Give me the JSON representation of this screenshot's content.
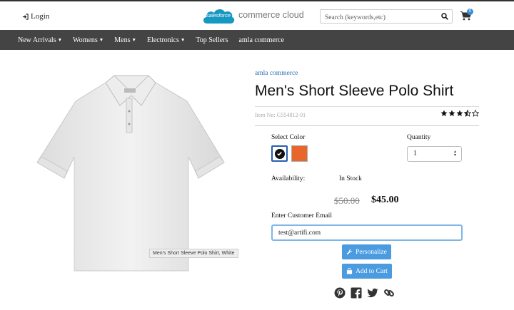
{
  "header": {
    "login_label": "Login",
    "logo_cloud_text": "salesforce",
    "logo_text": "commerce cloud",
    "search_placeholder": "Search (keywords,etc)",
    "cart_count": "0"
  },
  "nav": {
    "items": [
      {
        "label": "New Arrivals",
        "has_dropdown": true
      },
      {
        "label": "Womens",
        "has_dropdown": true
      },
      {
        "label": "Mens",
        "has_dropdown": true
      },
      {
        "label": "Electronics",
        "has_dropdown": true
      },
      {
        "label": "Top Sellers",
        "has_dropdown": false
      },
      {
        "label": "amla commerce",
        "has_dropdown": false
      }
    ]
  },
  "product": {
    "image_tooltip": "Men's Short Sleeve Polo Shirt, White",
    "brand": "amla commerce",
    "title": "Men's Short Sleeve Polo Shirt",
    "item_no": "Item No: G554812-01",
    "rating": 3.5,
    "rating_max": 5,
    "select_color_label": "Select Color",
    "colors": [
      {
        "name": "White",
        "hex": "#ffffff",
        "selected": true
      },
      {
        "name": "Orange",
        "hex": "#e8652b",
        "selected": false
      }
    ],
    "quantity_label": "Quantity",
    "quantity_value": "1",
    "availability_label": "Availability:",
    "availability_value": "In Stock",
    "old_price": "$50.00",
    "price": "$45.00",
    "email_label": "Enter Customer Email",
    "email_value": "test@artifi.com",
    "personalize_label": "Personalize",
    "add_to_cart_label": "Add to Cart"
  },
  "social": [
    "pinterest-icon",
    "facebook-icon",
    "twitter-icon",
    "link-icon"
  ],
  "colors": {
    "nav_bg": "#444444",
    "accent_blue": "#4a9be0",
    "link_blue": "#2a6fb8",
    "logo_blue": "#1798c1"
  }
}
